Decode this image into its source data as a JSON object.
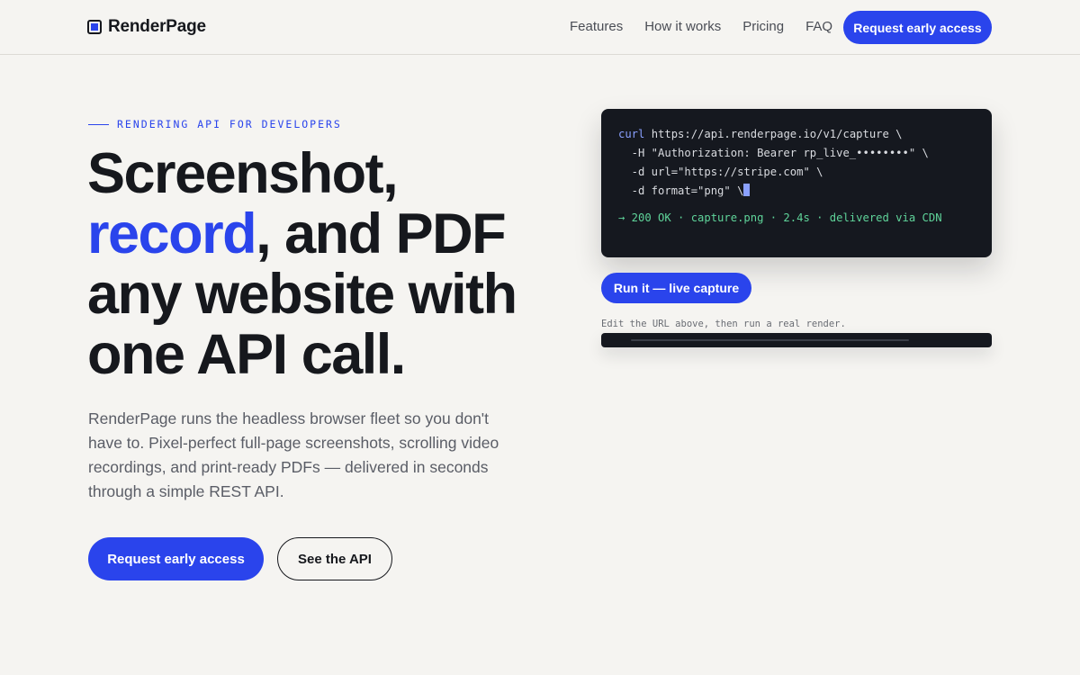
{
  "brand": {
    "name": "RenderPage",
    "icon": "square-logo-icon",
    "accent": "#2a44ec"
  },
  "nav": {
    "items": [
      "Features",
      "How it works",
      "Pricing",
      "FAQ"
    ],
    "cta": "Request early access"
  },
  "hero": {
    "eyebrow": "RENDERING API FOR DEVELOPERS",
    "headline_parts": [
      "Screenshot,",
      "record",
      ", and PDF any website with one API call."
    ],
    "subtext": "RenderPage runs the headless browser fleet so you don't have to. Pixel-perfect full-page screenshots, scrolling video recordings, and print-ready PDFs — delivered in seconds through a simple REST API.",
    "primary_cta": "Request early access",
    "secondary_cta": "See the API"
  },
  "code": {
    "cmd": "curl",
    "line1_rest": " https://api.renderpage.io/v1/capture \\",
    "line2": "  -H \"Authorization: Bearer rp_live_••••••••\" \\",
    "line3": "  -d url=\"https://stripe.com\" \\",
    "line4": "  -d format=\"png\" \\",
    "result": "→ 200 OK · capture.png · 2.4s · delivered via CDN"
  },
  "demo": {
    "run_label": "Run it — live capture",
    "hint": "Edit the URL above, then run a real render.",
    "progress": 0.84
  }
}
